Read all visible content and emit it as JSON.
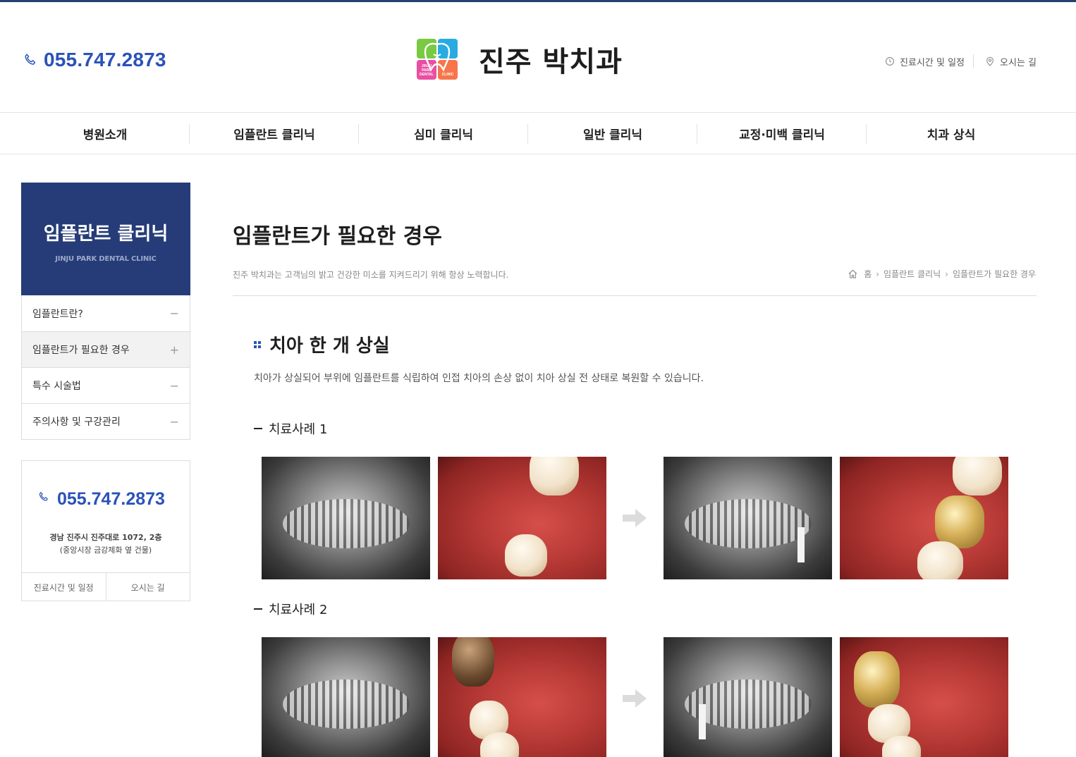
{
  "header": {
    "phone": "055.747.2873",
    "logo_title": "진주 박치과",
    "logo_mark_lines": [
      "JINJU",
      "PARK",
      "DENTAL",
      "CLINIC"
    ],
    "links": [
      {
        "label": "진료시간 및 일정",
        "icon": "clock-icon"
      },
      {
        "label": "오시는 길",
        "icon": "location-pin-icon"
      }
    ]
  },
  "nav": {
    "items": [
      "병원소개",
      "임플란트 클리닉",
      "심미 클리닉",
      "일반 클리닉",
      "교정·미백 클리닉",
      "치과 상식"
    ]
  },
  "sidebar": {
    "title": "임플란트 클리닉",
    "subtitle": "JINJU PARK DENTAL CLINIC",
    "menu": [
      {
        "label": "임플란트란?",
        "sign": "−"
      },
      {
        "label": "임플란트가 필요한 경우",
        "sign": "+"
      },
      {
        "label": "특수 시술법",
        "sign": "−"
      },
      {
        "label": "주의사항 및 구강관리",
        "sign": "−"
      }
    ],
    "card": {
      "phone": "055.747.2873",
      "address_line1": "경남 진주시 진주대로 1072, 2층",
      "address_line2": "(중앙시장 금강제화 옆 건물)",
      "buttons": [
        "진료시간 및 일정",
        "오시는 길"
      ]
    }
  },
  "main": {
    "title": "임플란트가 필요한 경우",
    "subtitle": "진주 박치과는 고객님의 밝고 건강한 미소를 지켜드리기 위해 항상 노력합니다.",
    "breadcrumb": [
      "홈",
      "임플란트 클리닉",
      "임플란트가 필요한 경우"
    ],
    "section_title": "치아 한 개 상실",
    "section_desc": "치아가 상실되어 부위에 임플란트를 식립하여 인접 치아의 손상 없이 치아 상실 전 상태로 복원할 수 있습니다.",
    "cases": [
      {
        "title": "치료사례 1"
      },
      {
        "title": "치료사례 2"
      }
    ]
  },
  "colors": {
    "brand_navy": "#263c78",
    "phone_blue": "#2b52b8",
    "top_line": "#25406f"
  }
}
